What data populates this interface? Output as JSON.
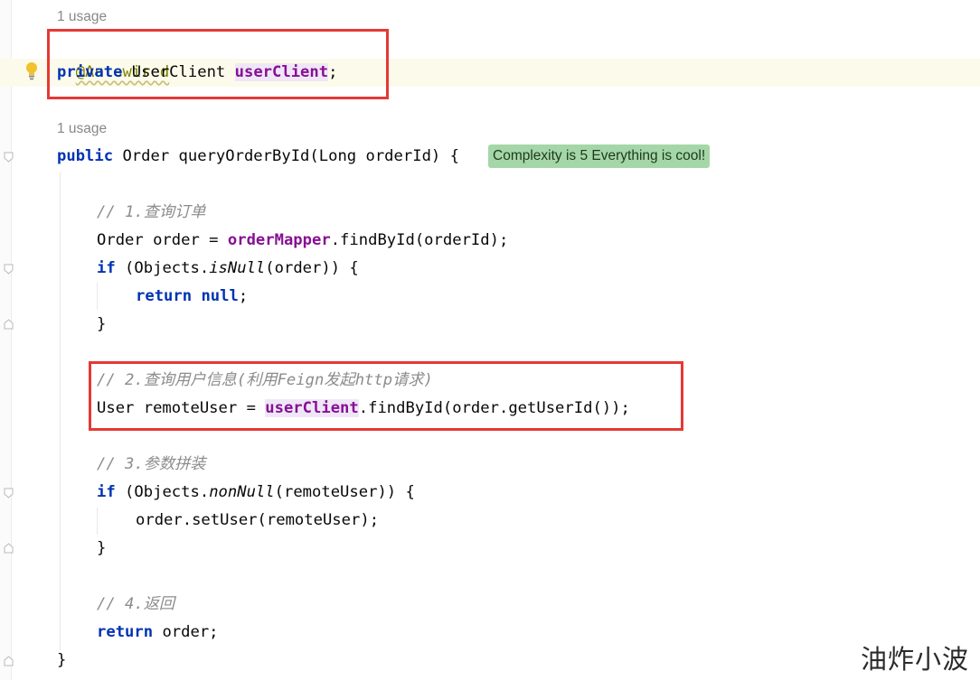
{
  "editor": {
    "usage_field": "1 usage",
    "usage_method": "1 usage",
    "annotation": "@Autowired",
    "field_decl": {
      "kw_private": "private",
      "type": " UserClient ",
      "name": "userClient",
      "end": ";"
    },
    "method_sig": {
      "kw_public": "public",
      "rest": " Order queryOrderById(Long orderId) {"
    },
    "complexity_hint": "Complexity is 5 Everything is cool!",
    "comment1": "// 1.查询订单",
    "line_order": {
      "prefix": "Order order = ",
      "mapper": "orderMapper",
      "suffix": ".findById(orderId);"
    },
    "if1": {
      "kw_if": "if",
      "a": " (Objects.",
      "method": "isNull",
      "b": "(order)) {"
    },
    "return_null": {
      "kw_return": "return",
      "sp": " ",
      "kw_null": "null",
      "end": ";"
    },
    "close1": "}",
    "comment2": "// 2.查询用户信息(利用Feign发起http请求)",
    "remote_line": {
      "prefix": "User remoteUser = ",
      "client": "userClient",
      "suffix": ".findById(order.getUserId());"
    },
    "comment3": "// 3.参数拼装",
    "if2": {
      "kw_if": "if",
      "a": " (Objects.",
      "method": "nonNull",
      "b": "(remoteUser)) {"
    },
    "set_user": "order.setUser(remoteUser);",
    "close2": "}",
    "comment4": "// 4.返回",
    "return_order": {
      "kw_return": "return",
      "rest": " order;"
    },
    "close_method": "}"
  },
  "watermark": "油炸小波",
  "colors": {
    "keyword": "#0033b3",
    "annotation": "#808000",
    "field": "#871094",
    "comment": "#8c8c8c",
    "highlight_box": "#e53935",
    "hint_badge": "#a5d6a7"
  },
  "icons": {
    "gutter_bulb": "lightbulb-icon",
    "fold_markers": "fold-icon"
  }
}
